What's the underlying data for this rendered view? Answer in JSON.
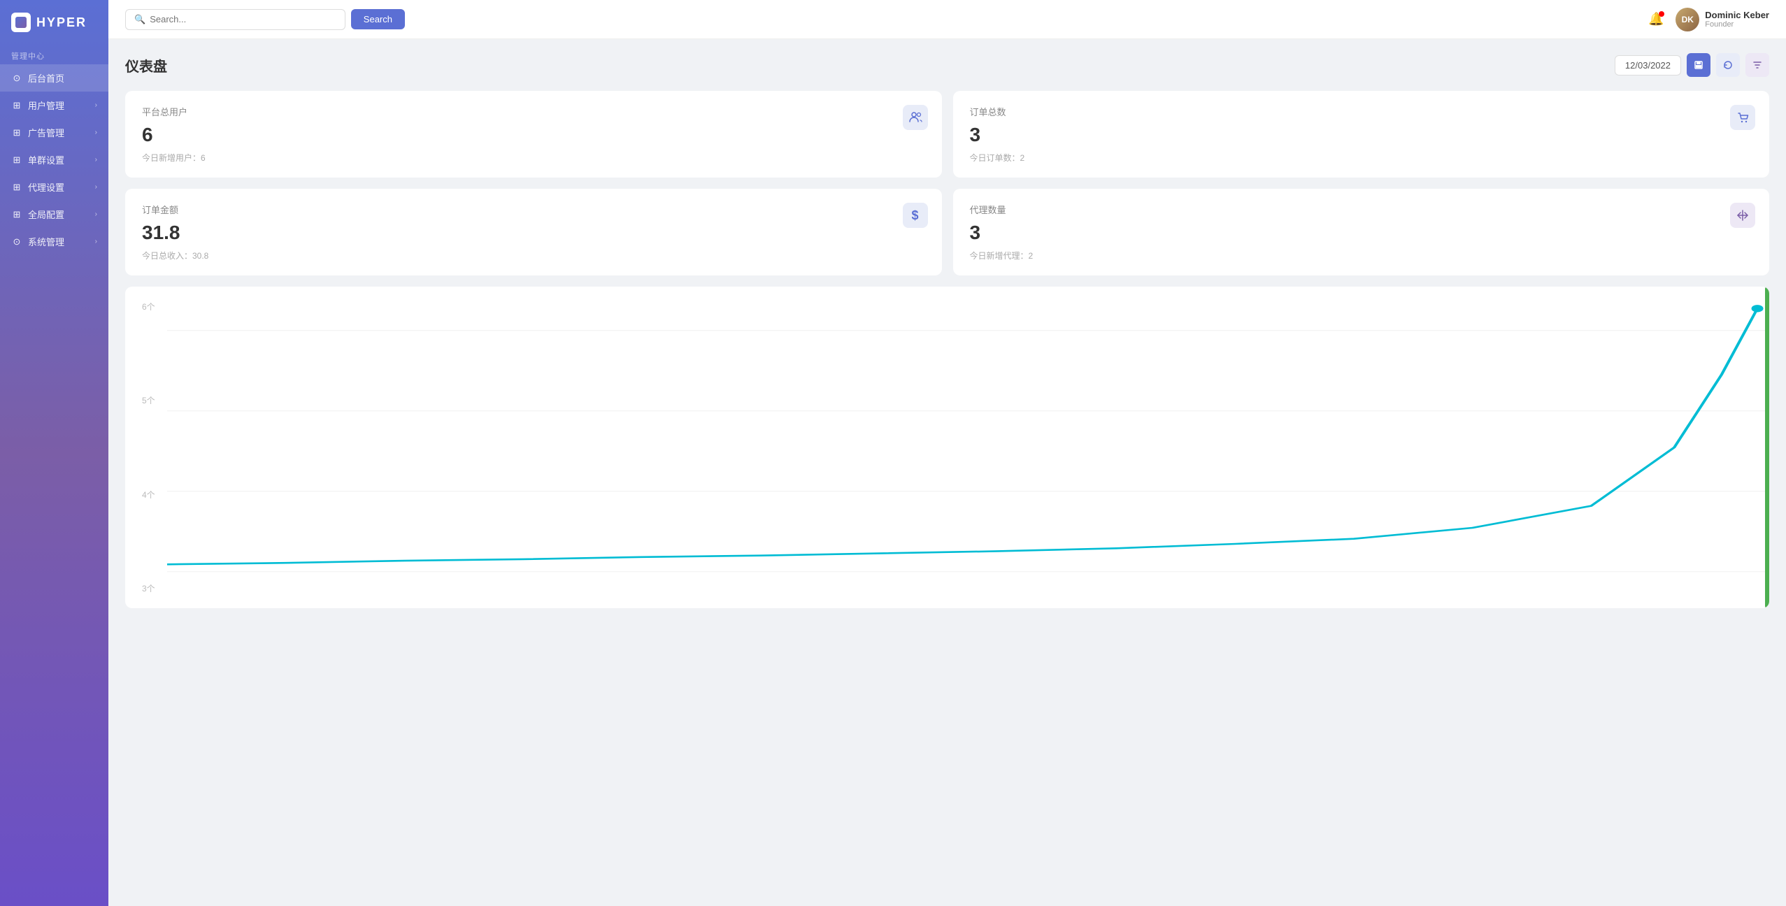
{
  "app": {
    "name": "HYPER"
  },
  "sidebar": {
    "section_label": "管理中心",
    "items": [
      {
        "id": "home",
        "label": "后台首页",
        "icon": "⊙",
        "active": true,
        "has_chevron": false
      },
      {
        "id": "users",
        "label": "用户管理",
        "icon": "⊞",
        "active": false,
        "has_chevron": true
      },
      {
        "id": "ads",
        "label": "广告管理",
        "icon": "⊞",
        "active": false,
        "has_chevron": true
      },
      {
        "id": "groups",
        "label": "单群设置",
        "icon": "⊞",
        "active": false,
        "has_chevron": true
      },
      {
        "id": "agent",
        "label": "代理设置",
        "icon": "⊞",
        "active": false,
        "has_chevron": true
      },
      {
        "id": "global",
        "label": "全局配置",
        "icon": "⊞",
        "active": false,
        "has_chevron": true
      },
      {
        "id": "system",
        "label": "系统管理",
        "icon": "⊙",
        "active": false,
        "has_chevron": true
      }
    ]
  },
  "header": {
    "search_placeholder": "Search...",
    "search_button": "Search",
    "user": {
      "name": "Dominic Keber",
      "role": "Founder",
      "initials": "DK"
    }
  },
  "page": {
    "title": "仪表盘",
    "date": "12/03/2022",
    "actions": [
      "save",
      "refresh",
      "filter"
    ]
  },
  "stats": [
    {
      "id": "total_users",
      "title": "平台总用户",
      "value": "6",
      "sub": "今日新增用户：6",
      "icon": "👥",
      "icon_type": "blue"
    },
    {
      "id": "total_orders",
      "title": "订单总数",
      "value": "3",
      "sub": "今日订单数：2",
      "icon": "🛒",
      "icon_type": "blue"
    },
    {
      "id": "order_amount",
      "title": "订单金额",
      "value": "31.8",
      "sub": "今日总收入：30.8",
      "icon": "$",
      "icon_type": "blue"
    },
    {
      "id": "agent_count",
      "title": "代理数量",
      "value": "3",
      "sub": "今日新增代理：2",
      "icon": "↔",
      "icon_type": "purple"
    }
  ],
  "chart": {
    "y_labels": [
      "6个",
      "5个",
      "4个",
      "3个"
    ],
    "line_color": "#00bcd4"
  }
}
